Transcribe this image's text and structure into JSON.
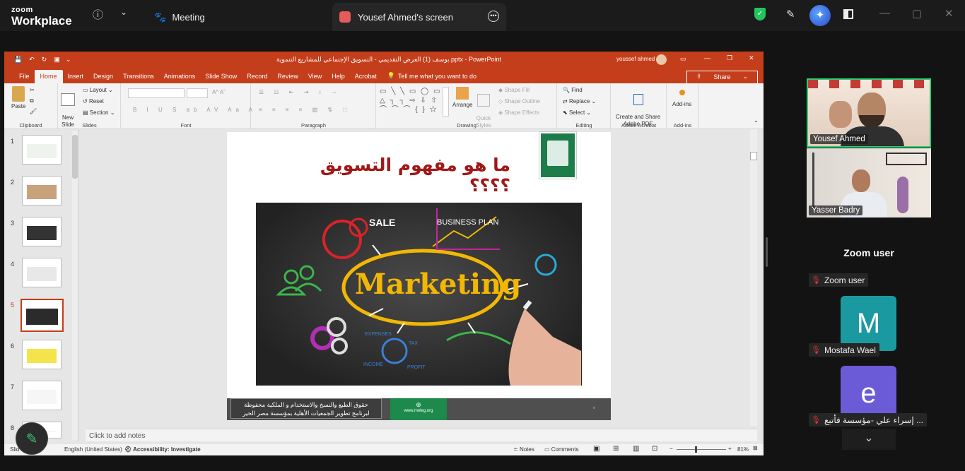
{
  "app": {
    "logo_top": "zoom",
    "logo_bottom": "Workplace"
  },
  "topbar": {
    "meeting_tab": "Meeting",
    "share_tab": "Yousef Ahmed's screen"
  },
  "ppt": {
    "doc_title": "بوسف (1) العرض التقديمي - التسويق الإجتماعي للمشاريع التنموية.pptx  -  PowerPoint",
    "user": "youssef ahmed",
    "menu": [
      "File",
      "Home",
      "Insert",
      "Design",
      "Transitions",
      "Animations",
      "Slide Show",
      "Record",
      "Review",
      "View",
      "Help",
      "Acrobat"
    ],
    "tell_me": "Tell me what you want to do",
    "share": "Share",
    "ribbon": {
      "paste": "Paste",
      "clipboard": "Clipboard",
      "new_slide": "New\nSlide",
      "layout": "Layout",
      "reset": "Reset",
      "section": "Section",
      "slides": "Slides",
      "font": "Font",
      "paragraph": "Paragraph",
      "drawing": "Drawing",
      "arrange": "Arrange",
      "quick_styles": "Quick\nStyles",
      "shape_fill": "Shape Fill",
      "shape_outline": "Shape Outline",
      "shape_effects": "Shape Effects",
      "find": "Find",
      "replace": "Replace",
      "select": "Select",
      "editing": "Editing",
      "create_pdf": "Create and Share\nAdobe PDF",
      "adobe": "Adobe Acrobat",
      "addins": "Add-ins",
      "addins_grp": "Add-ins"
    },
    "slide_numbers": [
      "1",
      "2",
      "3",
      "4",
      "5",
      "6",
      "7",
      "8"
    ],
    "selected_slide": 5,
    "slide": {
      "title": "ما هو مفهوم التسويق  ؟؟؟؟",
      "footer_text": "حقوق الطبع والنسخ والاستخدام و الملكية محفوظة\nلبرنامج تطوير الجمعيات الأهلية بمؤسسة مصر الخير",
      "footer_url": "www.meleg.org",
      "image_words": {
        "center": "Marketing",
        "sale": "SALE",
        "business": "BUSINESS  PLAN",
        "expenses": "EXPENSES",
        "tax": "TAX",
        "income": "INCOME",
        "profit": "PROFIT"
      }
    },
    "notes_placeholder": "Click to add notes",
    "status": {
      "slide": "Slid",
      "language": "English (United States)",
      "accessibility": "Accessibility: Investigate",
      "notes": "Notes",
      "comments": "Comments",
      "zoom": "81%"
    }
  },
  "participants": {
    "video": [
      {
        "name": "Yousef Ahmed"
      },
      {
        "name": "Yasser Badry"
      }
    ],
    "heading": "Zoom user",
    "list": [
      {
        "name": "Zoom user",
        "initial": "",
        "color": ""
      },
      {
        "name": "Mostafa Wael",
        "initial": "M",
        "color": "#1a9aa0"
      },
      {
        "name": "إسراء علي -مؤسسة فأتبع ...",
        "initial": "e",
        "color": "#6b5bd6"
      }
    ]
  },
  "colors": {
    "ppt_accent": "#c43e1c",
    "zoom_active_border": "#2ecc71"
  }
}
